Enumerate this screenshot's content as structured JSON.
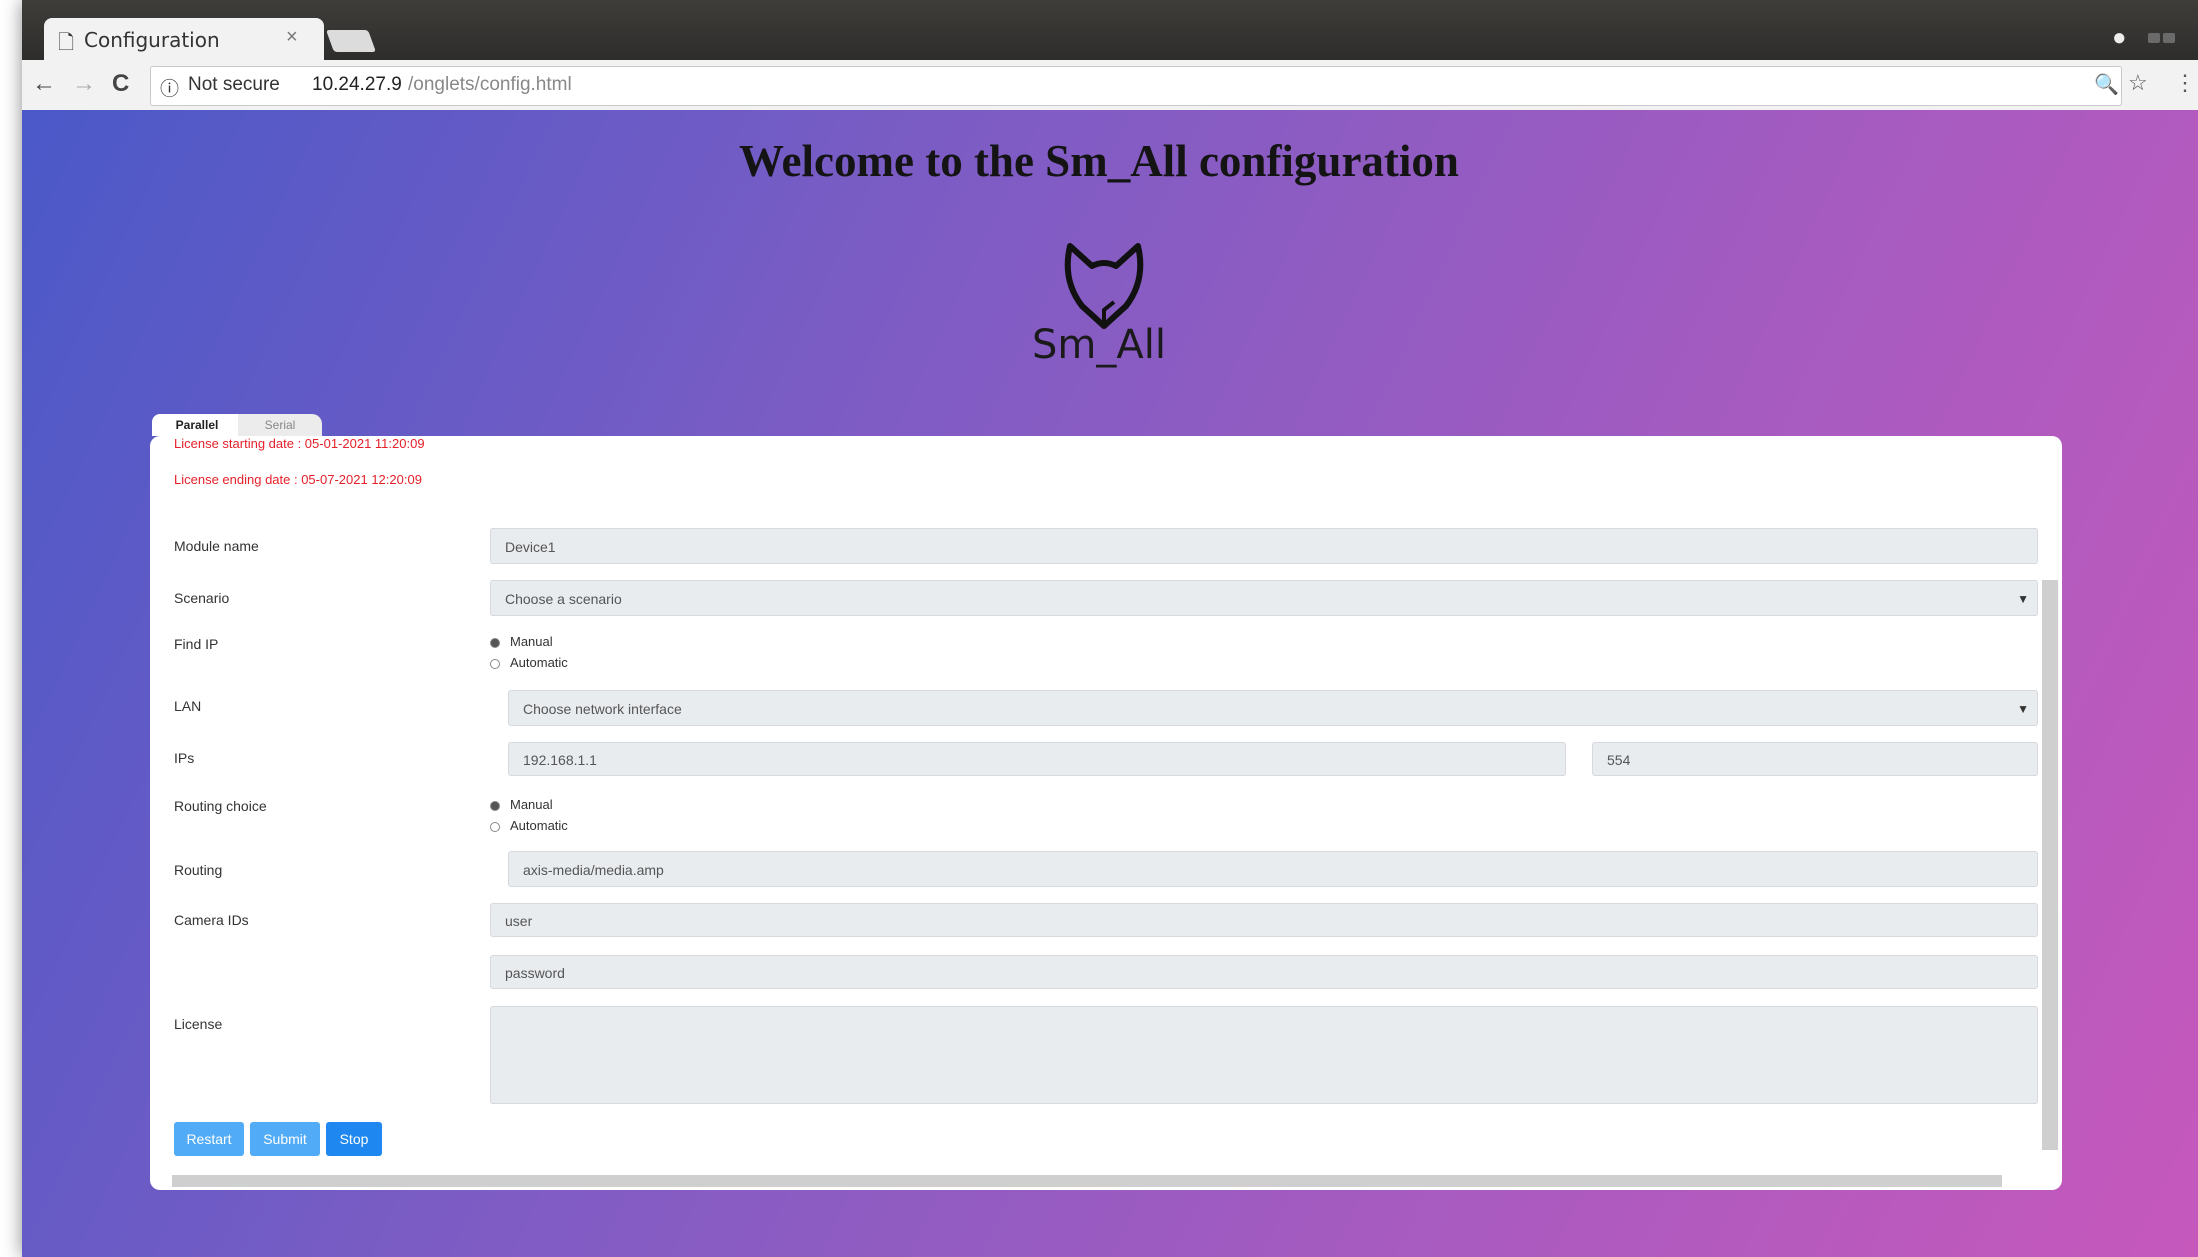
{
  "browser": {
    "tab_title": "Configuration",
    "tab_close": "×",
    "url_info_icon": "ⓘ",
    "url_secure": "Not secure",
    "url_host": "10.24.27.9",
    "url_path": "/onglets/config.html",
    "back": "←",
    "forward": "→",
    "reload": "C"
  },
  "page": {
    "heading": "Welcome to the Sm_All configuration",
    "brand": "Sm_All",
    "tabs": [
      "Parallel",
      "Serial"
    ],
    "license_start": "License starting date : 05-01-2021 11:20:09",
    "license_end": "License ending date : 05-07-2021 12:20:09",
    "form": {
      "module_name_label": "Module name",
      "module_name_value": "Device1",
      "scenario_label": "Scenario",
      "scenario_value": "Choose a scenario",
      "find_ip_label": "Find IP",
      "find_ip_options": [
        "Manual",
        "Automatic"
      ],
      "lan_label": "LAN",
      "lan_value": "Choose network interface",
      "ips_label": "IPs",
      "ip_value": "192.168.1.1",
      "port_value": "554",
      "routing_choice_label": "Routing choice",
      "routing_options": [
        "Manual",
        "Automatic"
      ],
      "routing_label": "Routing",
      "routing_value": "axis-media/media.amp",
      "camera_ids_label": "Camera IDs",
      "camera_user_value": "user",
      "camera_password_value": "password",
      "license_label": "License"
    },
    "buttons": {
      "restart": "Restart",
      "submit": "Submit",
      "stop": "Stop"
    }
  },
  "colors": {
    "button_light": "#52abf7",
    "button_primary": "#1e88f0",
    "license_text": "#e5202a"
  }
}
